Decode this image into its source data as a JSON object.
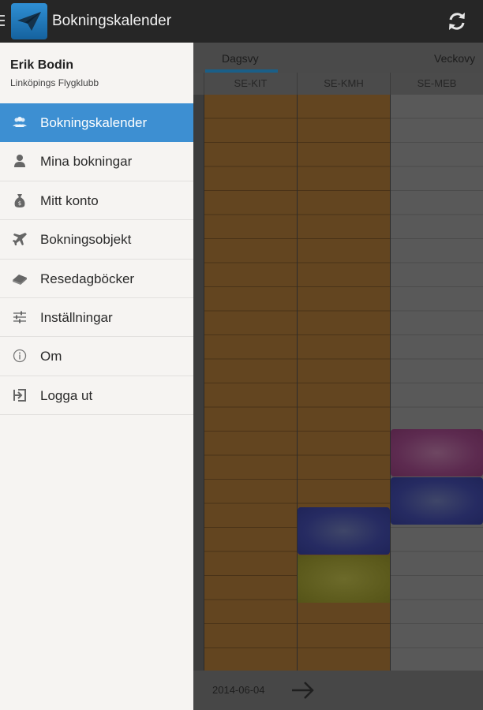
{
  "app": {
    "title": "Bokningskalender"
  },
  "drawer": {
    "user_name": "Erik Bodin",
    "club": "Linköpings Flygklubb",
    "items": [
      {
        "label": "Bokningskalender",
        "icon": "people-icon",
        "active": true
      },
      {
        "label": "Mina bokningar",
        "icon": "person-icon",
        "active": false
      },
      {
        "label": "Mitt konto",
        "icon": "money-bag-icon",
        "active": false
      },
      {
        "label": "Bokningsobjekt",
        "icon": "airplane-icon",
        "active": false
      },
      {
        "label": "Resedagböcker",
        "icon": "book-icon",
        "active": false
      },
      {
        "label": "Inställningar",
        "icon": "sliders-icon",
        "active": false
      },
      {
        "label": "Om",
        "icon": "info-icon",
        "active": false
      },
      {
        "label": "Logga ut",
        "icon": "logout-icon",
        "active": false
      }
    ]
  },
  "calendar": {
    "tabs": [
      "Dagsvy",
      "Veckovy"
    ],
    "active_tab": "Dagsvy",
    "columns": [
      "SE-KIT",
      "SE-KMH",
      "SE-MEB"
    ],
    "date": "2014-06-04"
  },
  "colors": {
    "accent": "#3d8fd2",
    "actionbar": "#262626",
    "drawer_bg": "#f6f4f2"
  }
}
